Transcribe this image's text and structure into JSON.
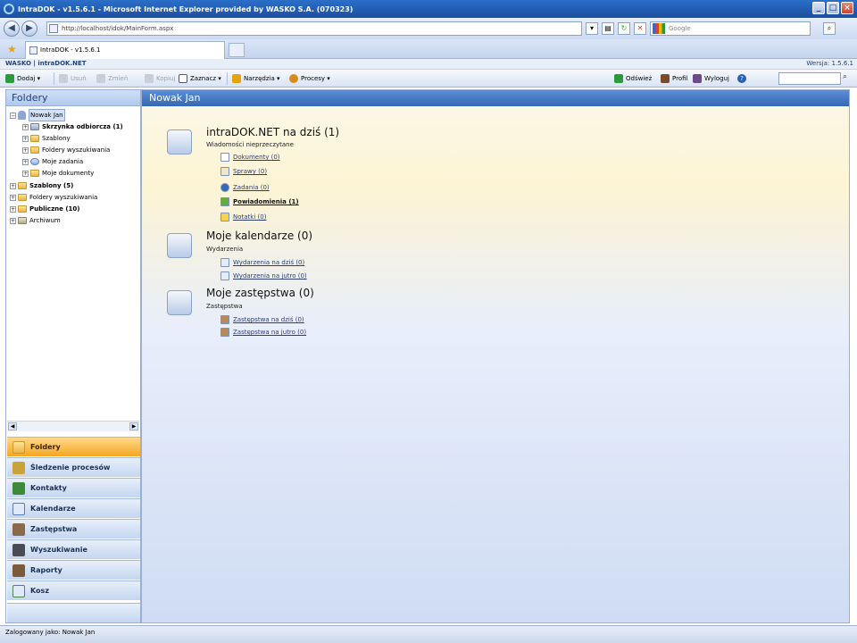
{
  "window": {
    "title": "IntraDOK - v1.5.6.1 - Microsoft Internet Explorer provided by WASKO S.A. (070323)"
  },
  "browser": {
    "address": "http://localhost/idok/MainForm.aspx",
    "search_placeholder": "Google",
    "tab_label": "IntraDOK - v1.5.6.1"
  },
  "app": {
    "logo": "WASKO | intraDOK.NET",
    "version": "Wersja: 1.5.6.1"
  },
  "toolbar": {
    "add": "Dodaj",
    "delete": "Usuń",
    "rename": "Zmień",
    "copy": "Kopiuj",
    "select": "Zaznacz",
    "tools": "Narzędzia",
    "processes": "Procesy",
    "refresh": "Odśwież",
    "profile": "Profil",
    "logout": "Wyloguj"
  },
  "sidebar": {
    "header": "Foldery",
    "tree": [
      {
        "label": "Nowak Jan"
      },
      {
        "label": "Skrzynka odbiorcza (1)"
      },
      {
        "label": "Szablony"
      },
      {
        "label": "Foldery wyszukiwania"
      },
      {
        "label": "Moje zadania"
      },
      {
        "label": "Moje dokumenty"
      },
      {
        "label": "Szablony (5)"
      },
      {
        "label": "Foldery wyszukiwania"
      },
      {
        "label": "Publiczne (10)"
      },
      {
        "label": "Archiwum"
      }
    ],
    "nav": [
      {
        "label": "Foldery"
      },
      {
        "label": "Śledzenie procesów"
      },
      {
        "label": "Kontakty"
      },
      {
        "label": "Kalendarze"
      },
      {
        "label": "Zastępstwa"
      },
      {
        "label": "Wyszukiwanie"
      },
      {
        "label": "Raporty"
      },
      {
        "label": "Kosz"
      }
    ]
  },
  "main": {
    "header": "Nowak Jan",
    "sections": [
      {
        "title": "intraDOK.NET na dziś (1)",
        "subtitle": "Wiadomości nieprzeczytane",
        "links": [
          "Dokumenty (0)",
          "Sprawy (0)",
          "Zadania (0)",
          "Powiadomienia (1)",
          "Notatki (0)"
        ]
      },
      {
        "title": "Moje kalendarze (0)",
        "subtitle": "Wydarzenia",
        "links": [
          "Wydarzenia na dziś (0)",
          "Wydarzenia na jutro (0)"
        ]
      },
      {
        "title": "Moje zastępstwa (0)",
        "subtitle": "Zastępstwa",
        "links": [
          "Zastępstwa na dziś (0)",
          "Zastępstwa na jutro (0)"
        ]
      }
    ]
  },
  "status": {
    "text": "Zalogowany jako: Nowak Jan"
  }
}
